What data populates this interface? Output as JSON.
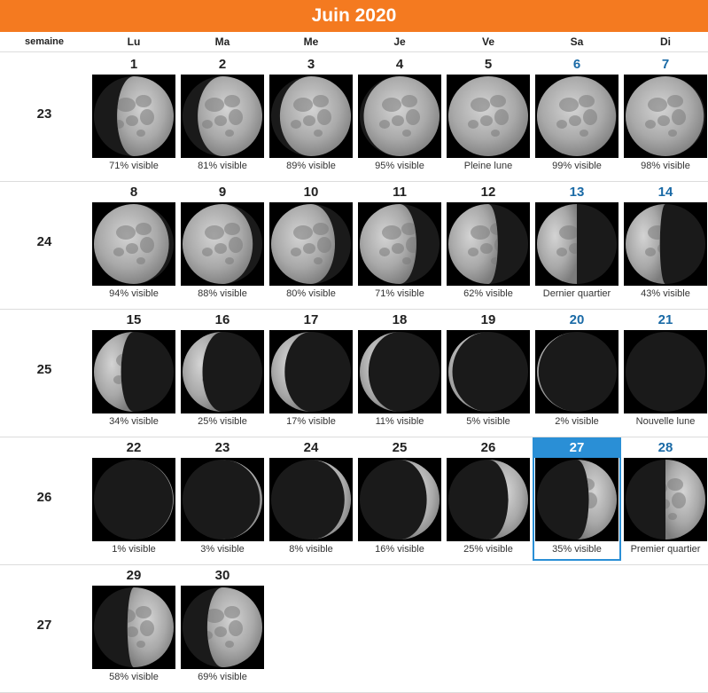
{
  "title": "Juin 2020",
  "colors": {
    "title_bg": "#f47a20",
    "weekend_text": "#1a6aa6",
    "today_accent": "#2a8fd6"
  },
  "headers": {
    "week": "semaine",
    "days": [
      "Lu",
      "Ma",
      "Me",
      "Je",
      "Ve",
      "Sa",
      "Di"
    ]
  },
  "weeks": [
    {
      "number": "23",
      "days": [
        {
          "day": "1",
          "caption": "71% visible",
          "illum": 0.71,
          "waxing": true
        },
        {
          "day": "2",
          "caption": "81% visible",
          "illum": 0.81,
          "waxing": true
        },
        {
          "day": "3",
          "caption": "89% visible",
          "illum": 0.89,
          "waxing": true
        },
        {
          "day": "4",
          "caption": "95% visible",
          "illum": 0.95,
          "waxing": true
        },
        {
          "day": "5",
          "caption": "Pleine lune",
          "illum": 1.0,
          "waxing": true
        },
        {
          "day": "6",
          "caption": "99% visible",
          "illum": 0.99,
          "waxing": false,
          "weekend": true
        },
        {
          "day": "7",
          "caption": "98% visible",
          "illum": 0.98,
          "waxing": false,
          "weekend": true
        }
      ]
    },
    {
      "number": "24",
      "days": [
        {
          "day": "8",
          "caption": "94% visible",
          "illum": 0.94,
          "waxing": false
        },
        {
          "day": "9",
          "caption": "88% visible",
          "illum": 0.88,
          "waxing": false
        },
        {
          "day": "10",
          "caption": "80% visible",
          "illum": 0.8,
          "waxing": false
        },
        {
          "day": "11",
          "caption": "71% visible",
          "illum": 0.71,
          "waxing": false
        },
        {
          "day": "12",
          "caption": "62% visible",
          "illum": 0.62,
          "waxing": false
        },
        {
          "day": "13",
          "caption": "Dernier quartier",
          "illum": 0.5,
          "waxing": false,
          "weekend": true
        },
        {
          "day": "14",
          "caption": "43% visible",
          "illum": 0.43,
          "waxing": false,
          "weekend": true
        }
      ]
    },
    {
      "number": "25",
      "days": [
        {
          "day": "15",
          "caption": "34% visible",
          "illum": 0.34,
          "waxing": false
        },
        {
          "day": "16",
          "caption": "25% visible",
          "illum": 0.25,
          "waxing": false
        },
        {
          "day": "17",
          "caption": "17% visible",
          "illum": 0.17,
          "waxing": false
        },
        {
          "day": "18",
          "caption": "11% visible",
          "illum": 0.11,
          "waxing": false
        },
        {
          "day": "19",
          "caption": "5% visible",
          "illum": 0.05,
          "waxing": false
        },
        {
          "day": "20",
          "caption": "2% visible",
          "illum": 0.02,
          "waxing": false,
          "weekend": true
        },
        {
          "day": "21",
          "caption": "Nouvelle lune",
          "illum": 0.0,
          "waxing": true,
          "weekend": true
        }
      ]
    },
    {
      "number": "26",
      "days": [
        {
          "day": "22",
          "caption": "1% visible",
          "illum": 0.01,
          "waxing": true
        },
        {
          "day": "23",
          "caption": "3% visible",
          "illum": 0.03,
          "waxing": true
        },
        {
          "day": "24",
          "caption": "8% visible",
          "illum": 0.08,
          "waxing": true
        },
        {
          "day": "25",
          "caption": "16% visible",
          "illum": 0.16,
          "waxing": true
        },
        {
          "day": "26",
          "caption": "25% visible",
          "illum": 0.25,
          "waxing": true
        },
        {
          "day": "27",
          "caption": "35% visible",
          "illum": 0.35,
          "waxing": true,
          "weekend": true,
          "today": true
        },
        {
          "day": "28",
          "caption": "Premier quartier",
          "illum": 0.5,
          "waxing": true,
          "weekend": true
        }
      ]
    },
    {
      "number": "27",
      "days": [
        {
          "day": "29",
          "caption": "58% visible",
          "illum": 0.58,
          "waxing": true
        },
        {
          "day": "30",
          "caption": "69% visible",
          "illum": 0.69,
          "waxing": true
        }
      ]
    }
  ]
}
